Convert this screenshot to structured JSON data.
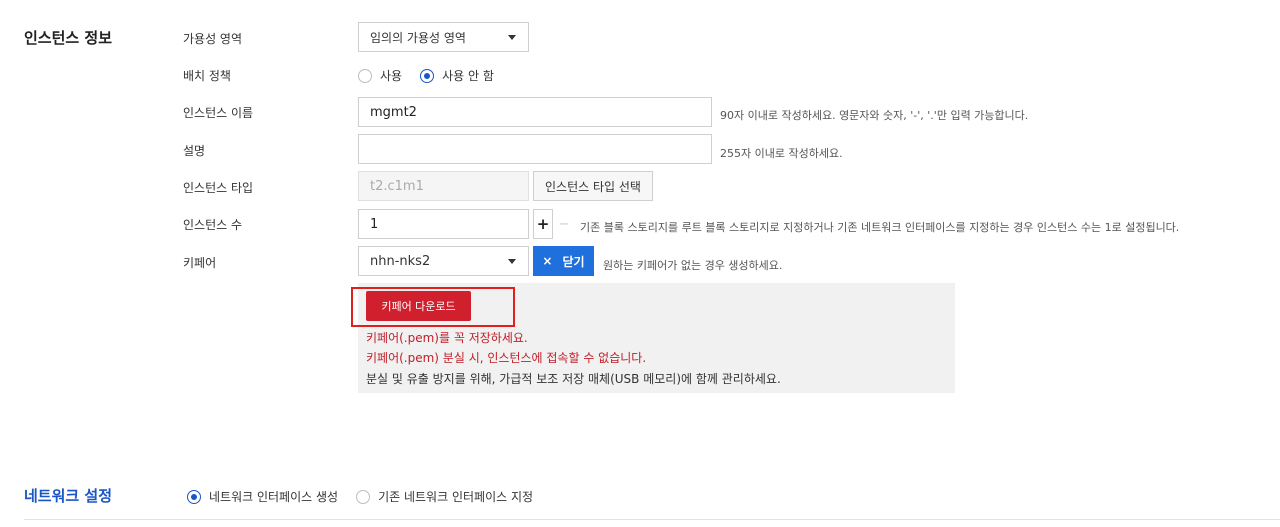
{
  "instance_info": {
    "section_title": "인스턴스 정보",
    "availability_zone": {
      "label": "가용성 영역",
      "value": "임의의 가용성 영역"
    },
    "placement_policy": {
      "label": "배치 정책",
      "options": [
        {
          "label": "사용",
          "checked": false
        },
        {
          "label": "사용 안 함",
          "checked": true
        }
      ]
    },
    "instance_name": {
      "label": "인스턴스 이름",
      "value": "mgmt2",
      "hint": "90자 이내로 작성하세요. 영문자와 숫자, '-', '.'만 입력 가능합니다."
    },
    "description": {
      "label": "설명",
      "value": "",
      "hint": "255자 이내로 작성하세요."
    },
    "instance_type": {
      "label": "인스턴스 타입",
      "value": "t2.c1m1",
      "button_label": "인스턴스 타입 선택"
    },
    "instance_count": {
      "label": "인스턴스 수",
      "value": "1",
      "plus": "+",
      "minus": "−",
      "hint": "기존 블록 스토리지를 루트 블록 스토리지로 지정하거나 기존 네트워크 인터페이스를 지정하는 경우 인스턴스 수는 1로 설정됩니다."
    },
    "keypair": {
      "label": "키페어",
      "value": "nhn-nks2",
      "close_icon": "×",
      "close_label": "닫기",
      "hint": "원하는 키페어가 없는 경우 생성하세요.",
      "download_label": "키페어 다운로드",
      "warning_1": "키페어(.pem)를 꼭 저장하세요.",
      "warning_2": "키페어(.pem) 분실 시, 인스턴스에 접속할 수 없습니다.",
      "note": "분실 및 유출 방지를 위해, 가급적 보조 저장 매체(USB 메모리)에 함께 관리하세요."
    }
  },
  "network_settings": {
    "section_title": "네트워크 설정",
    "options": [
      {
        "label": "네트워크 인터페이스 생성",
        "checked": true
      },
      {
        "label": "기존 네트워크 인터페이스 지정",
        "checked": false
      }
    ]
  },
  "colors": {
    "accent_blue": "#1f6fdc",
    "danger_red": "#d0202d",
    "highlight_red": "#e0201d"
  }
}
